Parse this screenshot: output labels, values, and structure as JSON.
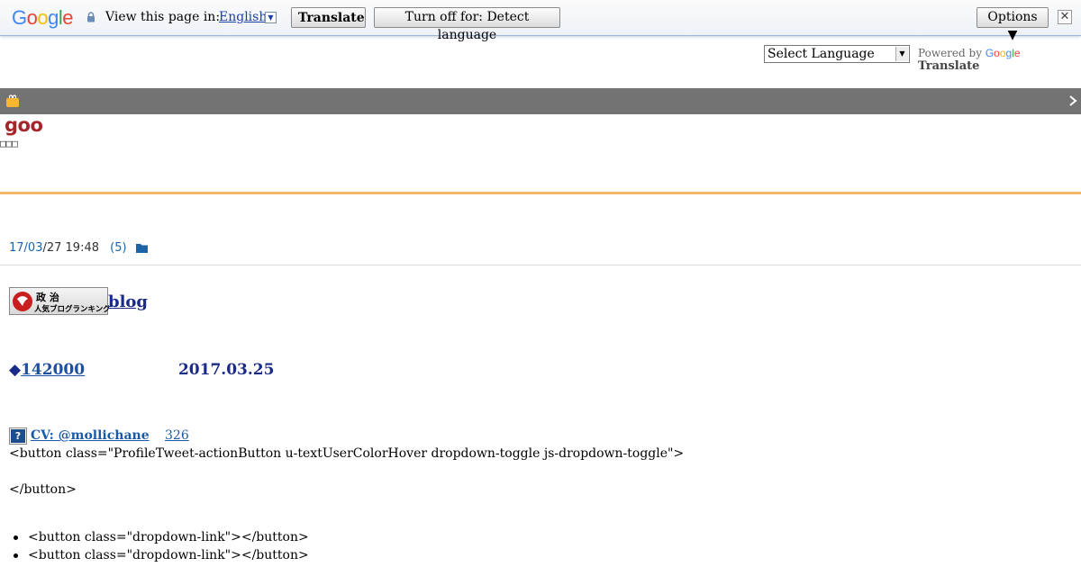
{
  "translate_bar": {
    "logo": {
      "letters": [
        "G",
        "o",
        "o",
        "g",
        "l",
        "e"
      ],
      "colors": [
        "#4285f4",
        "#ea4335",
        "#fbbc05",
        "#4285f4",
        "#34a853",
        "#ea4335"
      ]
    },
    "view_label": "View this page in:",
    "language": "English",
    "translate_button": "Translate",
    "turn_off_button": "Turn off for: Detect language",
    "options_button": "Options ▼",
    "close": "✕"
  },
  "language_widget": {
    "select_label": "Select Language",
    "powered_by": "Powered by",
    "google_word": "Google",
    "translate_word": "Translate"
  },
  "site": {
    "logo": "goo",
    "subtitle": "□□□"
  },
  "post": {
    "date_link": "17/03",
    "date_rest": "/27 19:48",
    "comments": "(5)",
    "ranking_banner": {
      "line1": "政 治",
      "line2": "人気ブログランキング"
    },
    "blog_link": "blog",
    "headline_link": "142000",
    "headline_rest": " 2017.03.25",
    "cv_link": "CV:      @mollichane",
    "cv_count": "326",
    "code_lines": [
      "<button class=\"ProfileTweet-actionButton u-textUserColorHover dropdown-toggle js-dropdown-toggle\">",
      "</button>"
    ],
    "bullets": [
      "<button class=\"dropdown-link\"></button>",
      "<button class=\"dropdown-link\"></button>"
    ]
  },
  "colors": {
    "accent_orange": "#f4b86a",
    "grey_bar": "#737373",
    "goo_red": "#a4262b",
    "link_blue": "#1a2a88"
  }
}
